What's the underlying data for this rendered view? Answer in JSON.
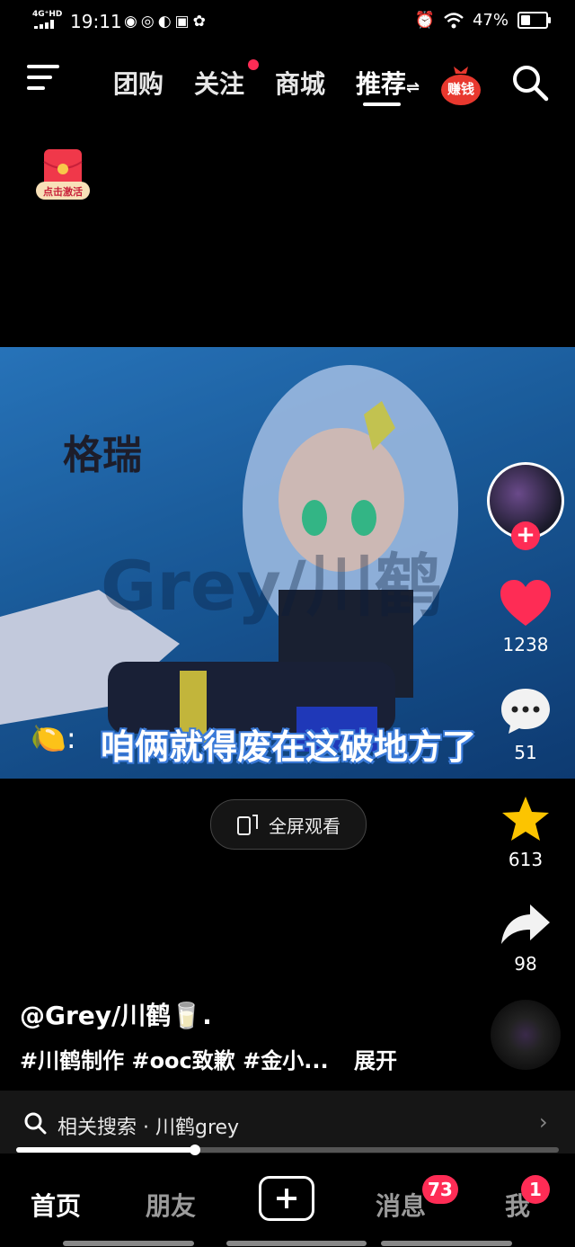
{
  "status_bar": {
    "network": "4G⁺HD",
    "time": "19:11",
    "battery": "47%",
    "battery_level": 0.47
  },
  "top_nav": {
    "tabs": [
      "团购",
      "关注",
      "商城",
      "推荐"
    ],
    "active_tab": "推荐",
    "earn_label": "赚钱"
  },
  "red_packet": {
    "label": "点击激活"
  },
  "video": {
    "overlay_title": "格瑞",
    "watermark": "Grey/川鹤",
    "subtitle_emoji": "🍋:",
    "subtitle": "咱俩就得废在这破地方了"
  },
  "fullscreen_button": {
    "label": "全屏观看"
  },
  "right_rail": {
    "likes": "1238",
    "comments": "51",
    "favorites": "613",
    "shares": "98"
  },
  "caption": {
    "author": "@Grey/川鹤🥛.",
    "tags": "#川鹤制作 #ooc致歉 #金小...",
    "expand": "展开"
  },
  "related_search": {
    "text": "相关搜索 · 川鹤grey"
  },
  "playback_progress": 0.33,
  "bottom_nav": {
    "home": "首页",
    "friends": "朋友",
    "messages": "消息",
    "messages_badge": "73",
    "me": "我",
    "me_badge": "1"
  },
  "colors": {
    "accent": "#fe2c55",
    "like": "#fe2c55",
    "favorite": "#fcc400",
    "background": "#000000"
  }
}
